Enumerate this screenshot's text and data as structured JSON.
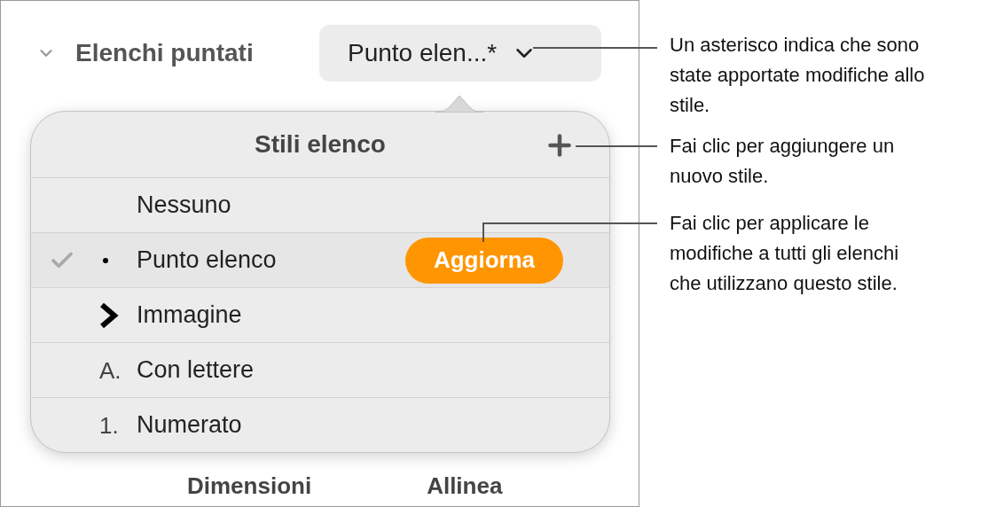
{
  "section": {
    "title": "Elenchi puntati",
    "expanded": true,
    "style_popup": {
      "value": "Punto elen...*"
    }
  },
  "popover": {
    "title": "Stili elenco",
    "items": [
      {
        "label": "Nessuno",
        "kind": "none",
        "selected": false
      },
      {
        "label": "Punto elenco",
        "kind": "bullet",
        "selected": true,
        "update_button": "Aggiorna"
      },
      {
        "label": "Immagine",
        "kind": "image",
        "selected": false
      },
      {
        "label": "Con lettere",
        "kind": "text",
        "marker": "A.",
        "selected": false
      },
      {
        "label": "Numerato",
        "kind": "text",
        "marker": "1.",
        "selected": false
      }
    ]
  },
  "tabs": [
    {
      "label": "Dimensioni"
    },
    {
      "label": "Allinea"
    }
  ],
  "callouts": [
    {
      "text": "Un asterisco indica che sono state apportate modifiche allo stile."
    },
    {
      "text": "Fai clic per aggiungere un nuovo stile."
    },
    {
      "text": "Fai clic per applicare le modifiche a tutti gli elenchi che utilizzano questo stile."
    }
  ]
}
